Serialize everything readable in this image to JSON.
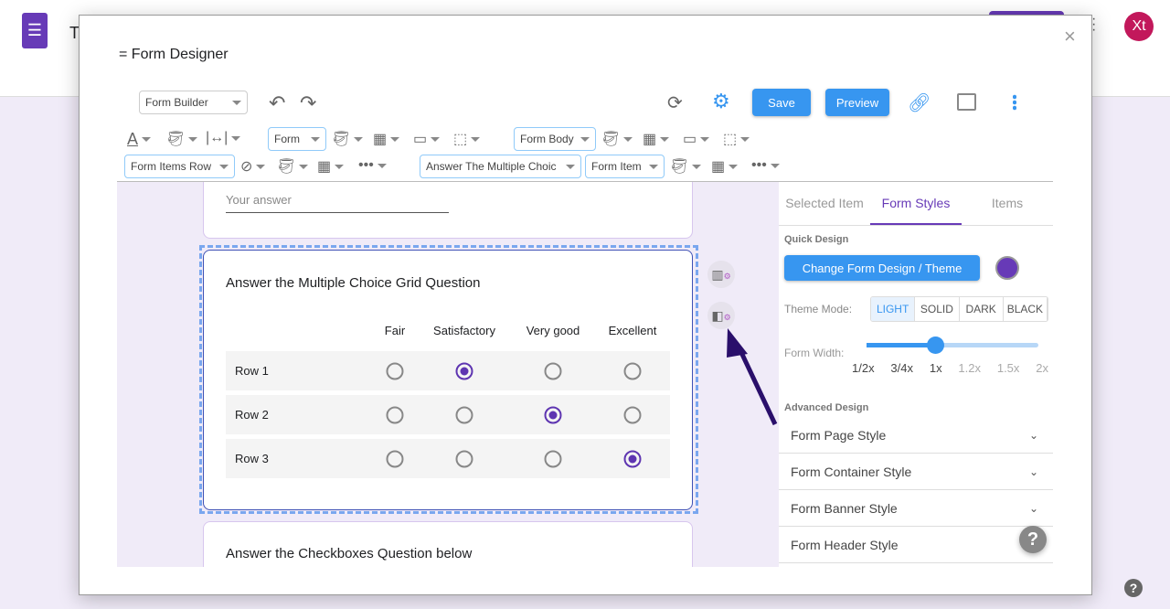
{
  "app": {
    "title_partial": "T",
    "avatar": "Xt",
    "accent": "#673ab7"
  },
  "dialog": {
    "title": "= Form Designer",
    "close": "×"
  },
  "toolbar": {
    "mode_select": "Form Builder",
    "save": "Save",
    "preview": "Preview",
    "row1": {
      "form_select": "Form",
      "body_select": "Form Body"
    },
    "row2": {
      "items_row_select": "Form Items Row",
      "question_select": "Answer The Multiple Choic",
      "item_select": "Form Item"
    }
  },
  "canvas": {
    "prev_placeholder": "Your answer",
    "grid_question": {
      "title": "Answer the Multiple Choice Grid Question",
      "columns": [
        "Fair",
        "Satisfactory",
        "Very good",
        "Excellent"
      ],
      "rows": [
        {
          "label": "Row 1",
          "selected": 1
        },
        {
          "label": "Row 2",
          "selected": 2
        },
        {
          "label": "Row 3",
          "selected": 3
        }
      ]
    },
    "next_question": "Answer the Checkboxes Question below"
  },
  "panel": {
    "tabs": [
      "Selected Item",
      "Form Styles",
      "Items"
    ],
    "active_tab": 1,
    "quick_design": "Quick Design",
    "change_theme": "Change Form Design / Theme",
    "theme_color": "#673ab7",
    "theme_mode_label": "Theme Mode:",
    "modes": [
      "LIGHT",
      "SOLID",
      "DARK",
      "BLACK"
    ],
    "active_mode": 0,
    "width_label": "Form Width:",
    "width_ticks": [
      "1/2x",
      "3/4x",
      "1x",
      "1.2x",
      "1.5x",
      "2x"
    ],
    "width_value": "1x",
    "advanced": "Advanced Design",
    "sections": [
      "Form Page Style",
      "Form Container Style",
      "Form Banner Style",
      "Form Header Style"
    ]
  },
  "help": "?"
}
